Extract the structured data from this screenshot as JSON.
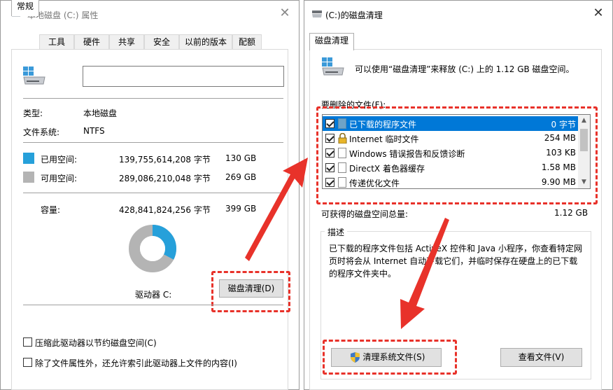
{
  "props_window": {
    "title": "本地磁盘 (C:) 属性",
    "tabs": [
      "常规",
      "工具",
      "硬件",
      "共享",
      "安全",
      "以前的版本",
      "配额"
    ],
    "name_value": "",
    "type_label": "类型:",
    "type_value": "本地磁盘",
    "fs_label": "文件系统:",
    "fs_value": "NTFS",
    "used_label": "已用空间:",
    "used_bytes": "139,755,614,208 字节",
    "used_gb": "130 GB",
    "free_label": "可用空间:",
    "free_bytes": "289,086,210,048 字节",
    "free_gb": "269 GB",
    "cap_label": "容量:",
    "cap_bytes": "428,841,824,256 字节",
    "cap_gb": "399 GB",
    "used_fraction": 0.326,
    "drive_label": "驱动器 C:",
    "cleanup_button": "磁盘清理(D)",
    "compress_label": "压缩此驱动器以节约磁盘空间(C)",
    "index_label": "除了文件属性外，还允许索引此驱动器上文件的内容(I)",
    "colors": {
      "used": "#26a0da",
      "free": "#b4b4b4"
    }
  },
  "cleanup_window": {
    "title": "(C:)的磁盘清理",
    "tab": "磁盘清理",
    "intro": "可以使用“磁盘清理”来释放  (C:) 上的 1.12 GB 磁盘空间。",
    "files_label": "要删除的文件(F):",
    "files": [
      {
        "name": "已下载的程序文件",
        "size": "0 字节",
        "checked": true,
        "icon": "folder-icon"
      },
      {
        "name": "Internet 临时文件",
        "size": "254 MB",
        "checked": true,
        "icon": "lock-icon"
      },
      {
        "name": "Windows 错误报告和反馈诊断",
        "size": "103 KB",
        "checked": true,
        "icon": "file-icon"
      },
      {
        "name": "DirectX 着色器缓存",
        "size": "1.58 MB",
        "checked": true,
        "icon": "file-icon"
      },
      {
        "name": "传递优化文件",
        "size": "9.90 MB",
        "checked": true,
        "icon": "file-icon"
      }
    ],
    "total_label": "可获得的磁盘空间总量:",
    "total_value": "1.12 GB",
    "desc_label": "描述",
    "desc_lines": [
      "已下载的程序文件包括 ActiveX 控件和 Java 小程序，你查看特定网",
      "页时将会从 Internet 自动下载它们，并临时保存在硬盘上的已下载",
      "的程序文件夹中。"
    ],
    "clean_sys_button": "清理系统文件(S)",
    "view_files_button": "查看文件(V)",
    "annotation_color": "#e8322a"
  }
}
